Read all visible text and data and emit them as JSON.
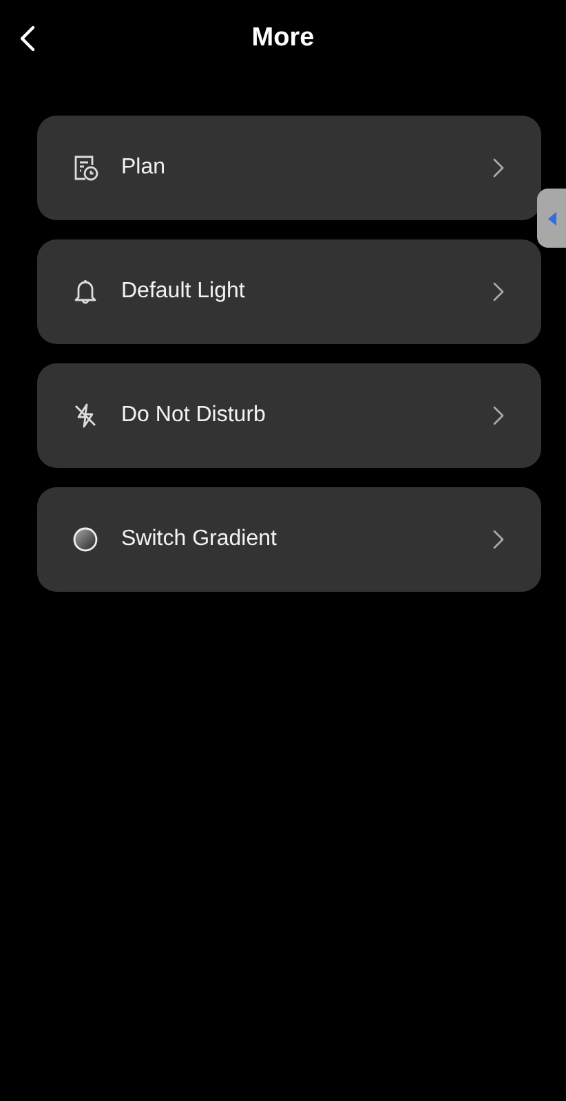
{
  "header": {
    "title": "More"
  },
  "items": [
    {
      "kind": "plan",
      "label": "Plan"
    },
    {
      "kind": "bell",
      "label": "Default Light"
    },
    {
      "kind": "mute",
      "label": "Do Not Disturb"
    },
    {
      "kind": "gradient",
      "label": "Switch Gradient"
    }
  ]
}
